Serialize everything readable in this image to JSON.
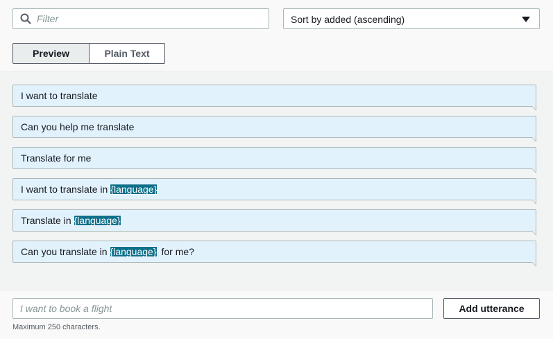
{
  "filter": {
    "placeholder": "Filter",
    "icon": "search-icon"
  },
  "sort": {
    "selected": "Sort by added (ascending)"
  },
  "tabs": [
    {
      "label": "Preview",
      "active": true
    },
    {
      "label": "Plain Text",
      "active": false
    }
  ],
  "utterances": [
    {
      "text": "I want to translate",
      "slot": "",
      "after": ""
    },
    {
      "text": "Can you help me translate",
      "slot": "",
      "after": ""
    },
    {
      "text": "Translate for me",
      "slot": "",
      "after": ""
    },
    {
      "text": "I want to translate in",
      "slot": "{language}",
      "after": ""
    },
    {
      "text": "Translate in",
      "slot": "{language}",
      "after": ""
    },
    {
      "text": "Can you translate in",
      "slot": "{language}",
      "after": "for me?"
    }
  ],
  "new_utterance": {
    "placeholder": "I want to book a flight",
    "button_label": "Add utterance",
    "hint": "Maximum 250 characters."
  },
  "colors": {
    "bubble_bg": "#e2f2fd",
    "slot_bg": "#0d6f8a",
    "border": "#aab7b8"
  }
}
